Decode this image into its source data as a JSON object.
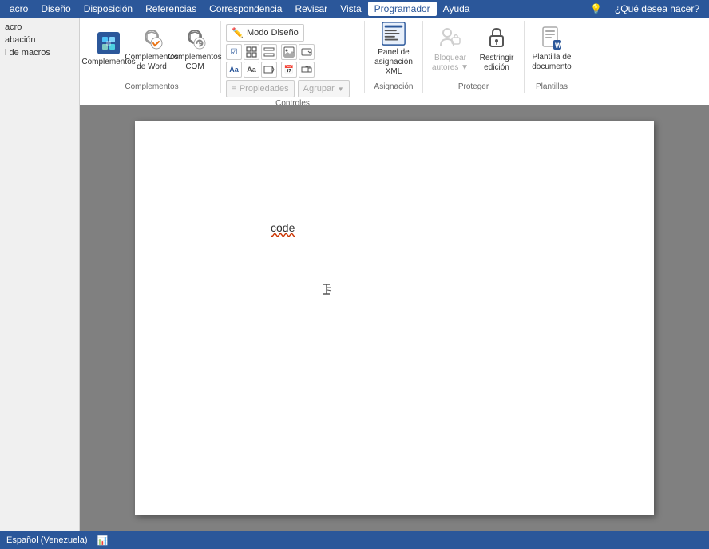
{
  "menubar": {
    "items": [
      "acro",
      "Diseño",
      "Disposición",
      "Referencias",
      "Correspondencia",
      "Revisar",
      "Vista",
      "Programador",
      "Ayuda"
    ],
    "active_tab": "Programador",
    "help_label": "¿Qué desea hacer?",
    "icon_lightbulb": "💡"
  },
  "ribbon": {
    "groups": [
      {
        "id": "complementos",
        "label": "Complementos",
        "buttons": [
          {
            "id": "complementos-btn",
            "label": "Complementos",
            "icon": "puzzle"
          },
          {
            "id": "complementos-word",
            "label": "Complementos\nde Word",
            "icon": "gear-orange"
          },
          {
            "id": "complementos-com",
            "label": "Complementos\nCOM",
            "icon": "gear-gray"
          }
        ]
      },
      {
        "id": "controles",
        "label": "Controles",
        "mode_label": "Modo Diseño",
        "prop_label": "Propiedades",
        "group_label": "Agrupar"
      },
      {
        "id": "asignacion",
        "label": "Asignación",
        "buttons": [
          {
            "id": "panel-asignacion",
            "label": "Panel de\nasignación XML",
            "icon": "xml"
          }
        ]
      },
      {
        "id": "proteger",
        "label": "Proteger",
        "buttons": [
          {
            "id": "bloquear-autores",
            "label": "Bloquear\nautores",
            "icon": "lock-person",
            "disabled": true
          },
          {
            "id": "restringir-edicion",
            "label": "Restringir\nedición",
            "icon": "lock"
          }
        ]
      },
      {
        "id": "plantillas",
        "label": "Plantillas",
        "buttons": [
          {
            "id": "plantilla-documento",
            "label": "Plantilla de\ndocumento",
            "icon": "word-doc"
          }
        ]
      }
    ],
    "left_sidebar": {
      "items": [
        "acro",
        "abación",
        "l de macros"
      ]
    }
  },
  "document": {
    "content": "code",
    "language": "Español (Venezuela)"
  },
  "statusbar": {
    "language": "Español (Venezuela)",
    "icon": "📊"
  }
}
